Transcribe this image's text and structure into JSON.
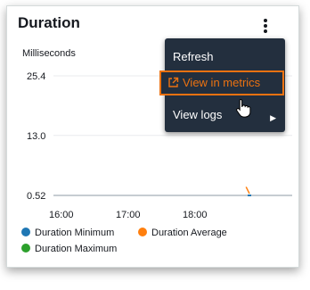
{
  "widget": {
    "title": "Duration",
    "unit_label": "Milliseconds"
  },
  "chart_data": {
    "type": "line",
    "ylabel": "Milliseconds",
    "y_ticks": [
      "25.4",
      "13.0",
      "0.52"
    ],
    "y_tick_values": [
      25.4,
      13.0,
      0.52
    ],
    "x_ticks": [
      "16:00",
      "17:00",
      "18:00"
    ],
    "ylim": [
      0.52,
      25.4
    ],
    "series": [
      {
        "name": "Duration Minimum",
        "color": "#1f77b4",
        "points": [
          [
            18.8,
            0.52
          ]
        ]
      },
      {
        "name": "Duration Average",
        "color": "#ff7f0e",
        "points": [
          [
            18.75,
            2.3
          ],
          [
            18.8,
            0.9
          ]
        ]
      },
      {
        "name": "Duration Maximum",
        "color": "#2ca02c",
        "points": []
      }
    ],
    "grid": true
  },
  "legend": {
    "items": [
      {
        "label": "Duration Minimum",
        "color": "#1f77b4"
      },
      {
        "label": "Duration Average",
        "color": "#ff7f0e"
      },
      {
        "label": "Duration Maximum",
        "color": "#2ca02c"
      }
    ]
  },
  "menu": {
    "refresh": "Refresh",
    "view_in_metrics": "View in metrics",
    "view_logs": "View logs",
    "submenu_icon": "triangle-right-icon",
    "highlight_color": "#ec7211"
  }
}
